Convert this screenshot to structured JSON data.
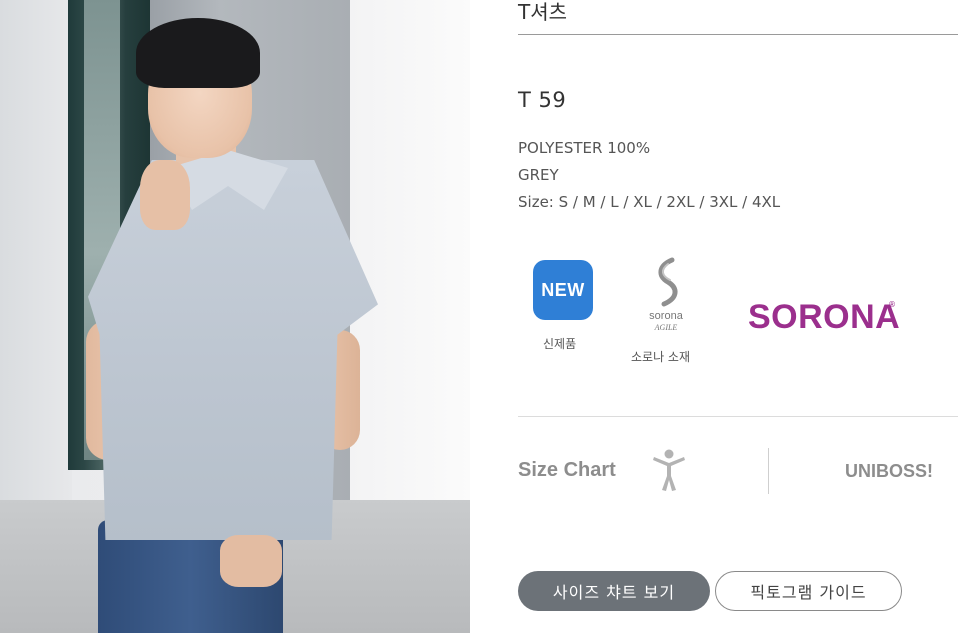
{
  "header": {
    "category_title": "T셔츠"
  },
  "product": {
    "code": "T 59",
    "material": "POLYESTER 100%",
    "color": "GREY",
    "sizes": "Size: S / M / L / XL / 2XL / 3XL / 4XL"
  },
  "badges": {
    "new": {
      "text": "NEW",
      "label": "신제품"
    },
    "sorona": {
      "label": "소로나 소재"
    },
    "sorona_wordmark": "SORONA",
    "registered": "®"
  },
  "size_section": {
    "label": "Size Chart",
    "brand": "UNIBOSS!"
  },
  "buttons": {
    "size_chart": "사이즈 챠트 보기",
    "pictogram": "픽토그램 가이드"
  },
  "colors": {
    "new_badge": "#2f7fd6",
    "sorona_purple": "#9b2f8d",
    "primary_button": "#6c7278"
  }
}
